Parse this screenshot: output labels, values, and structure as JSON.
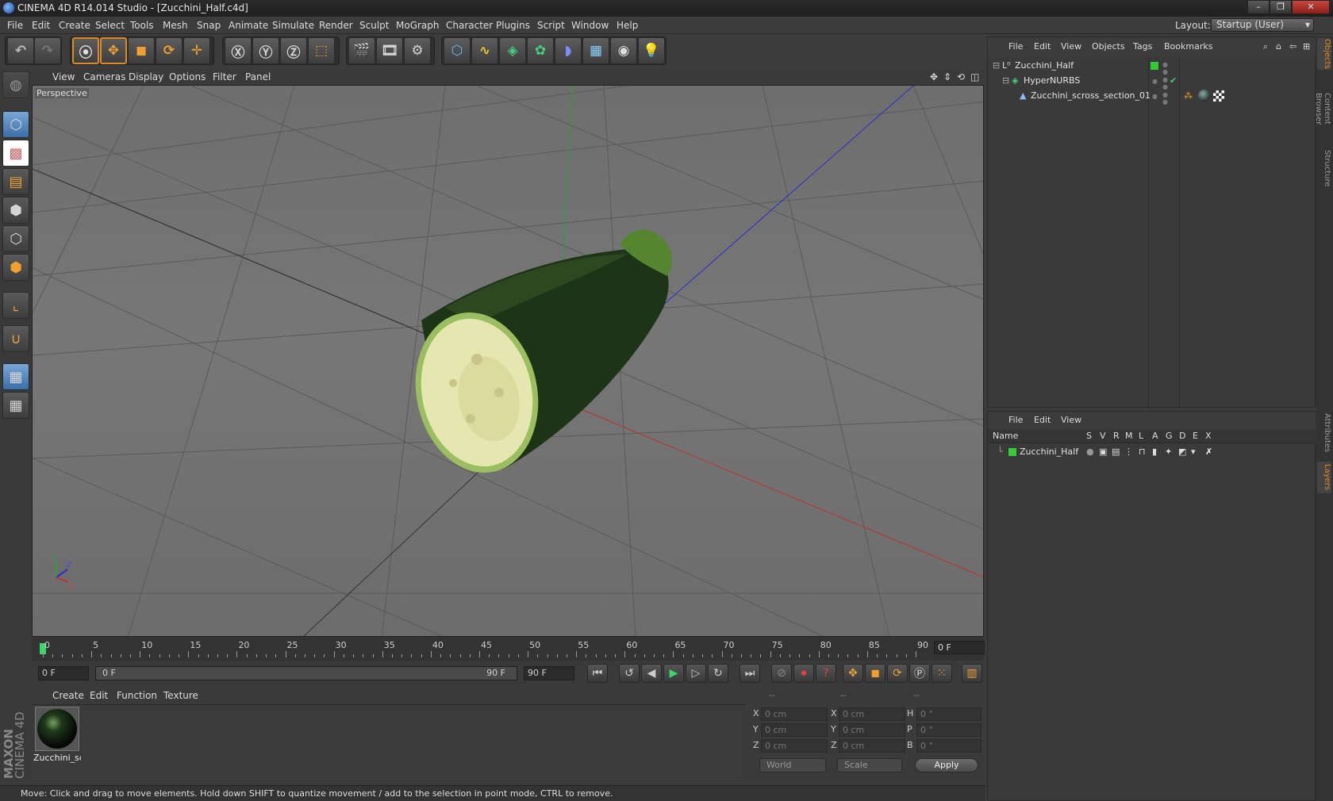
{
  "window": {
    "title": "CINEMA 4D R14.014 Studio - [Zucchini_Half.c4d]",
    "controls": [
      "minimize-icon",
      "maximize-icon",
      "close-icon"
    ]
  },
  "menubar": {
    "items": [
      "File",
      "Edit",
      "Create",
      "Select",
      "Tools",
      "Mesh",
      "Snap",
      "Animate",
      "Simulate",
      "Render",
      "Sculpt",
      "MoGraph",
      "Character",
      "Plugins",
      "Script",
      "Window",
      "Help"
    ],
    "layout_label": "Layout:",
    "layout_value": "Startup (User)"
  },
  "viewport": {
    "menu": [
      "View",
      "Cameras",
      "Display",
      "Options",
      "Filter",
      "Panel"
    ],
    "label": "Perspective",
    "axis_labels": [
      "Y",
      "Z",
      "X"
    ]
  },
  "timeline": {
    "ticks": [
      "0",
      "5",
      "10",
      "15",
      "20",
      "25",
      "30",
      "35",
      "40",
      "45",
      "50",
      "55",
      "60",
      "65",
      "70",
      "75",
      "80",
      "85",
      "90"
    ],
    "current_frame": "0 F",
    "start_field": "0 F",
    "range_start": "0 F",
    "range_end": "90 F",
    "end_field": "90 F"
  },
  "materials": {
    "menu": [
      "Create",
      "Edit",
      "Function",
      "Texture"
    ],
    "items": [
      {
        "name": "Zucchini_sc"
      }
    ]
  },
  "brand": {
    "name": "MAXON",
    "product": "CINEMA 4D"
  },
  "coordinates": {
    "headers": [
      "--",
      "--",
      "--"
    ],
    "rows": [
      {
        "a": "X",
        "av": "0 cm",
        "b": "X",
        "bv": "0 cm",
        "c": "H",
        "cv": "0 °"
      },
      {
        "a": "Y",
        "av": "0 cm",
        "b": "Y",
        "bv": "0 cm",
        "c": "P",
        "cv": "0 °"
      },
      {
        "a": "Z",
        "av": "0 cm",
        "b": "Z",
        "bv": "0 cm",
        "c": "B",
        "cv": "0 °"
      }
    ],
    "mode": "World",
    "type": "Scale",
    "apply": "Apply"
  },
  "status": "Move: Click and drag to move elements. Hold down SHIFT to quantize movement / add to the selection in point mode, CTRL to remove.",
  "objects": {
    "menu": [
      "File",
      "Edit",
      "View",
      "Objects",
      "Tags",
      "Bookmarks"
    ],
    "tree": [
      {
        "name": "Zucchini_Half"
      },
      {
        "name": "HyperNURBS"
      },
      {
        "name": "Zucchini_scross_section_01"
      }
    ]
  },
  "layers": {
    "menu": [
      "File",
      "Edit",
      "View"
    ],
    "columns": [
      "Name",
      "S",
      "V",
      "R",
      "M",
      "L",
      "A",
      "G",
      "D",
      "E",
      "X"
    ],
    "rows": [
      {
        "name": "Zucchini_Half",
        "color": "#33cc33"
      }
    ]
  },
  "side_tabs": [
    "Objects",
    "Content Browser",
    "Structure",
    "Attributes",
    "Layers"
  ],
  "colors": {
    "accent": "#e08a1e",
    "layer_green": "#33cc33",
    "x_axis": "#c03030",
    "y_axis": "#2fa02f",
    "z_axis": "#2a2ad0"
  }
}
